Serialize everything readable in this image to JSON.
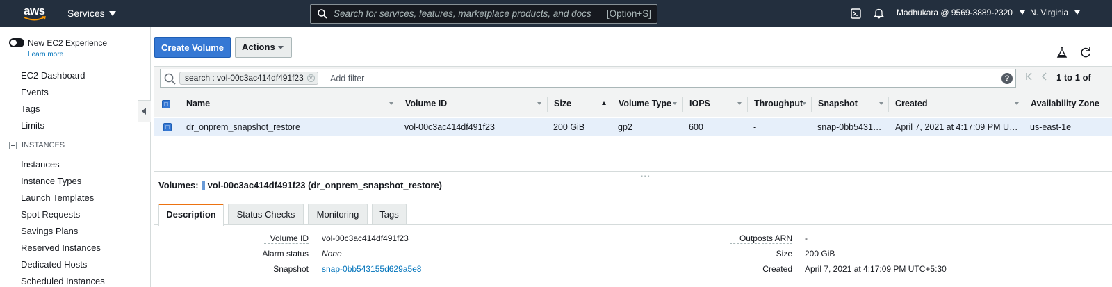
{
  "topnav": {
    "logo_text": "aws",
    "services_label": "Services",
    "search_placeholder": "Search for services, features, marketplace products, and docs",
    "search_shortcut": "[Option+S]",
    "account": "Madhukara @ 9569-3889-2320",
    "region": "N. Virginia"
  },
  "sidebar": {
    "new_experience_label": "New EC2 Experience",
    "learn_more": "Learn more",
    "items": [
      "EC2 Dashboard",
      "Events",
      "Tags",
      "Limits"
    ],
    "section_instances": "INSTANCES",
    "instance_items": [
      "Instances",
      "Instance Types",
      "Launch Templates",
      "Spot Requests",
      "Savings Plans",
      "Reserved Instances",
      "Dedicated Hosts",
      "Scheduled Instances"
    ]
  },
  "toolbar": {
    "create_volume": "Create Volume",
    "actions": "Actions"
  },
  "filter": {
    "token": "search : vol-00c3ac414df491f23",
    "add_filter": "Add filter",
    "help": "?",
    "pagination": "1 to 1 of"
  },
  "table": {
    "columns": [
      "Name",
      "Volume ID",
      "Size",
      "Volume Type",
      "IOPS",
      "Throughput",
      "Snapshot",
      "Created",
      "Availability Zone"
    ],
    "rows": [
      {
        "name": "dr_onprem_snapshot_restore",
        "volume_id": "vol-00c3ac414df491f23",
        "size": "200 GiB",
        "volume_type": "gp2",
        "iops": "600",
        "throughput": "-",
        "snapshot": "snap-0bb5431…",
        "created": "April 7, 2021 at 4:17:09 PM U…",
        "az": "us-east-1e"
      }
    ]
  },
  "details": {
    "title_prefix": "Volumes:",
    "title_value": "vol-00c3ac414df491f23 (dr_onprem_snapshot_restore)",
    "tabs": [
      "Description",
      "Status Checks",
      "Monitoring",
      "Tags"
    ],
    "left": [
      {
        "label": "Volume ID",
        "value": "vol-00c3ac414df491f23"
      },
      {
        "label": "Alarm status",
        "value": "None"
      },
      {
        "label": "Snapshot",
        "value": "snap-0bb543155d629a5e8"
      }
    ],
    "right": [
      {
        "label": "Outposts ARN",
        "value": "-"
      },
      {
        "label": "Size",
        "value": "200 GiB"
      },
      {
        "label": "Created",
        "value": "April 7, 2021 at 4:17:09 PM UTC+5:30"
      }
    ]
  },
  "colors": {
    "nav_bg": "#232f3e",
    "primary": "#3578d4",
    "link": "#0073bb",
    "selected_row": "#e6effa",
    "active_tab_accent": "#ec7211"
  }
}
